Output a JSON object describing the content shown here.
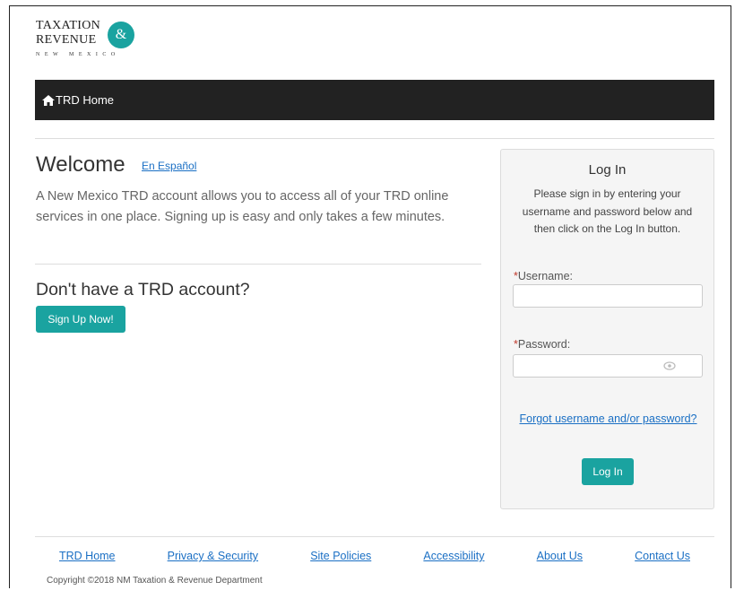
{
  "logo": {
    "line1": "TAXATION",
    "line2": "REVENUE",
    "amp": "&",
    "sub": "NEW MEXICO"
  },
  "nav": {
    "home_label": "TRD Home"
  },
  "welcome": {
    "title": "Welcome",
    "spanish_link": "En Español",
    "intro": "A New Mexico TRD account allows you to access all of your TRD online services in one place. Signing up is easy and only takes a few minutes."
  },
  "signup": {
    "title": "Don't have a TRD account?",
    "button": "Sign Up Now!"
  },
  "login": {
    "title": "Log In",
    "description": "Please sign in by entering your username and password below and then click on the Log In button.",
    "required_mark": "*",
    "username_label": "Username:",
    "username_value": "",
    "password_label": "Password:",
    "password_value": "",
    "forgot_link": "Forgot username and/or password?",
    "button": "Log In"
  },
  "footer": {
    "links": [
      "TRD Home",
      "Privacy & Security",
      "Site Policies",
      "Accessibility",
      "About Us",
      "Contact Us"
    ],
    "copyright": "Copyright ©2018 NM Taxation & Revenue Department"
  },
  "colors": {
    "accent": "#1aa3a0",
    "navbar": "#222222",
    "link": "#1a6fc4",
    "required": "#c0392b"
  }
}
